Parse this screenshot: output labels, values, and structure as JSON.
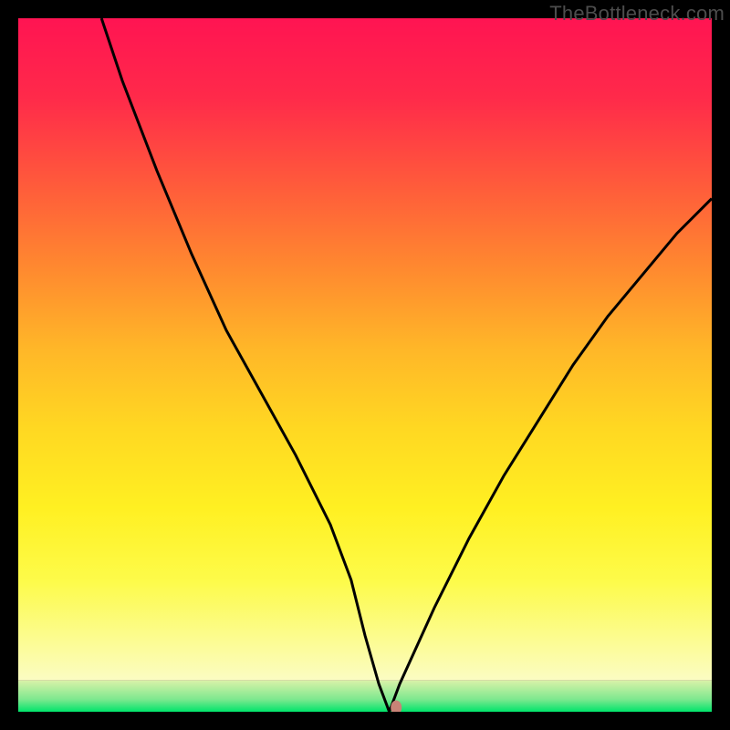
{
  "watermark": "TheBottleneck.com",
  "chart_data": {
    "type": "line",
    "title": "",
    "xlabel": "",
    "ylabel": "",
    "xlim": [
      0,
      100
    ],
    "ylim": [
      0,
      100
    ],
    "grid": false,
    "legend": false,
    "series": [
      {
        "name": "curve",
        "color": "#000000",
        "x": [
          12,
          15,
          20,
          25,
          30,
          35,
          40,
          45,
          48,
          50,
          52,
          53.5,
          55,
          60,
          65,
          70,
          75,
          80,
          85,
          90,
          95,
          100
        ],
        "y": [
          100,
          91,
          78,
          66,
          55,
          46,
          37,
          27,
          19,
          11,
          4,
          0,
          4,
          15,
          25,
          34,
          42,
          50,
          57,
          63,
          69,
          74
        ]
      }
    ],
    "marker": {
      "x": 54.5,
      "y": 0.6,
      "color": "#c98377",
      "rx": 6,
      "ry": 8
    },
    "bands": {
      "green_top_y": 4.5,
      "green_band_color_top": "#d9f2a8",
      "green_band_color_bottom": "#00e46b"
    },
    "gradient_stops": [
      {
        "offset": 0,
        "color": "#ff1452"
      },
      {
        "offset": 12,
        "color": "#ff2a4a"
      },
      {
        "offset": 25,
        "color": "#ff5a3b"
      },
      {
        "offset": 38,
        "color": "#ff8a2f"
      },
      {
        "offset": 50,
        "color": "#ffb728"
      },
      {
        "offset": 62,
        "color": "#ffd822"
      },
      {
        "offset": 74,
        "color": "#fff022"
      },
      {
        "offset": 85,
        "color": "#fdfb4a"
      },
      {
        "offset": 100,
        "color": "#fbfcc3"
      }
    ]
  }
}
